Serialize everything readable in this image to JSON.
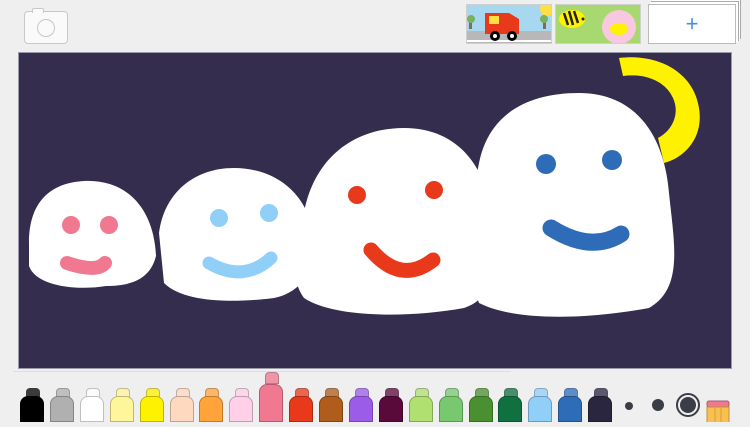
{
  "toolbar": {
    "camera_icon": "camera-icon",
    "add_page_label": "+"
  },
  "pages": [
    {
      "name": "fire-truck-page",
      "colors": {
        "sky": "#a8d8f0",
        "road": "#b8b8b8",
        "truck": "#e8391a"
      }
    },
    {
      "name": "bee-flower-page",
      "colors": {
        "bg": "#a8d870",
        "flower": "#f8c8e0",
        "bee": "#fff200"
      }
    }
  ],
  "canvas": {
    "background": "#352d4e"
  },
  "palette": {
    "colors": [
      "#000000",
      "#b0b0b0",
      "#ffffff",
      "#fff59a",
      "#fff200",
      "#ffd8c0",
      "#ffa33a",
      "#ffd0e8",
      "#f07890",
      "#e8391a",
      "#b05c1a",
      "#9b5de8",
      "#5a0a3a",
      "#b0e070",
      "#78c870",
      "#4a9030",
      "#107040",
      "#90d0f8",
      "#2f6cb8",
      "#2a2640"
    ],
    "selected_index": 8
  },
  "brush_sizes": {
    "options": [
      "small",
      "medium",
      "large"
    ],
    "selected": "large"
  },
  "eraser": {
    "icon": "eraser-icon"
  }
}
